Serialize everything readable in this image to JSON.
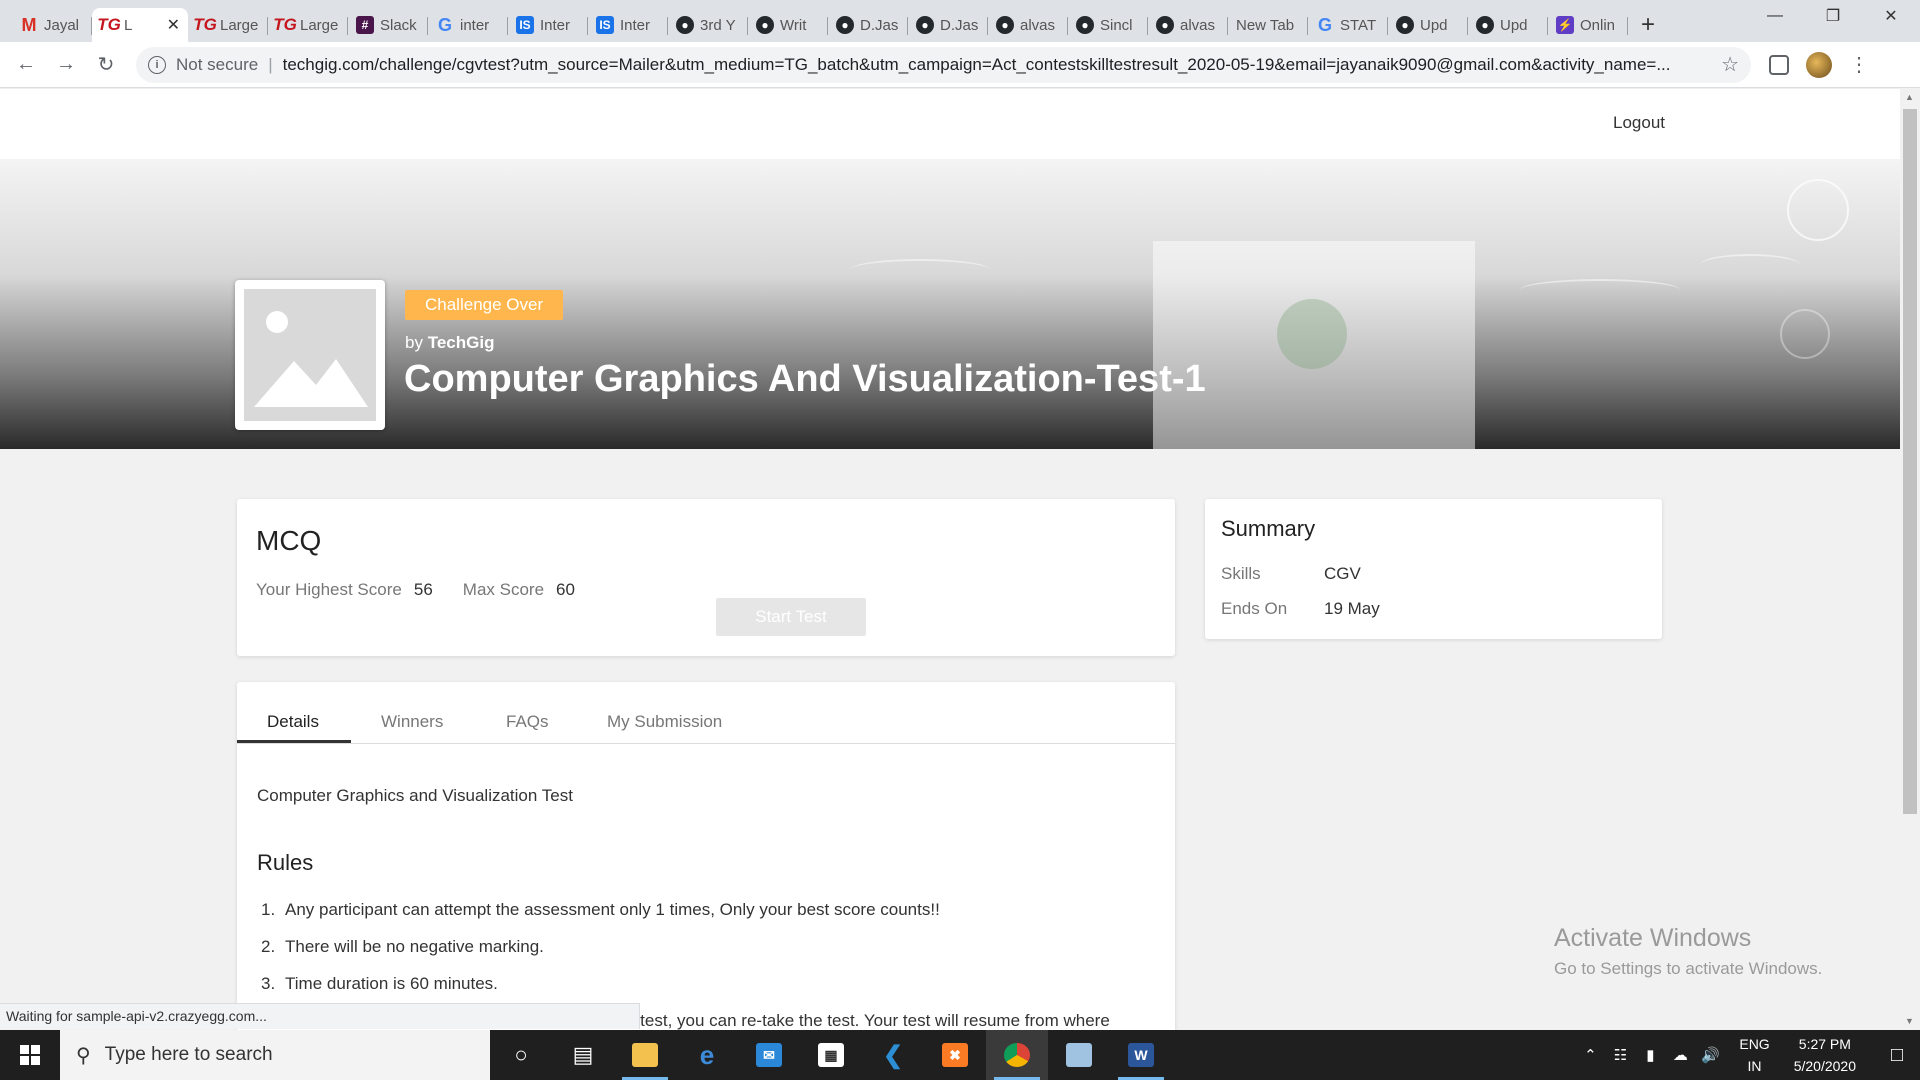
{
  "browser": {
    "tabs": [
      {
        "title": "Jayal",
        "icon": "gmail-icon",
        "glyph": "M",
        "kind": "gmail"
      },
      {
        "title": "L",
        "icon": "techgig-icon",
        "glyph": "TG",
        "kind": "tg",
        "active": true
      },
      {
        "title": "Large",
        "icon": "techgig-icon",
        "glyph": "TG",
        "kind": "tg"
      },
      {
        "title": "Large",
        "icon": "techgig-icon",
        "glyph": "TG",
        "kind": "tg"
      },
      {
        "title": "Slack",
        "icon": "slack-icon",
        "glyph": "#",
        "kind": "slack"
      },
      {
        "title": "inter",
        "icon": "google-icon",
        "glyph": "G",
        "kind": "google"
      },
      {
        "title": "Inter",
        "icon": "interviewbit-icon",
        "glyph": "IS",
        "kind": "is"
      },
      {
        "title": "Inter",
        "icon": "interviewbit-icon",
        "glyph": "IS",
        "kind": "is"
      },
      {
        "title": "3rd Y",
        "icon": "github-icon",
        "glyph": "●",
        "kind": "gh"
      },
      {
        "title": "Writ",
        "icon": "github-icon",
        "glyph": "●",
        "kind": "gh"
      },
      {
        "title": "D.Jas",
        "icon": "github-icon",
        "glyph": "●",
        "kind": "gh"
      },
      {
        "title": "D.Jas",
        "icon": "github-icon",
        "glyph": "●",
        "kind": "gh"
      },
      {
        "title": "alvas",
        "icon": "github-icon",
        "glyph": "●",
        "kind": "gh"
      },
      {
        "title": "Sincl",
        "icon": "github-icon",
        "glyph": "●",
        "kind": "gh"
      },
      {
        "title": "alvas",
        "icon": "github-icon",
        "glyph": "●",
        "kind": "gh"
      },
      {
        "title": "New Tab",
        "icon": "",
        "glyph": "",
        "kind": "none"
      },
      {
        "title": "STAT",
        "icon": "google-icon",
        "glyph": "G",
        "kind": "google"
      },
      {
        "title": "Upd",
        "icon": "github-icon",
        "glyph": "●",
        "kind": "gh"
      },
      {
        "title": "Upd",
        "icon": "github-icon",
        "glyph": "●",
        "kind": "gh"
      },
      {
        "title": "Onlin",
        "icon": "bolt-icon",
        "glyph": "⚡",
        "kind": "bolt"
      }
    ],
    "security_label": "Not secure",
    "url": "techgig.com/challenge/cgvtest?utm_source=Mailer&utm_medium=TG_batch&utm_campaign=Act_contestskilltestresult_2020-05-19&email=jayanaik9090@gmail.com&activity_name=...",
    "status_text": "Waiting for sample-api-v2.crazyegg.com..."
  },
  "site": {
    "logout_label": "Logout"
  },
  "hero": {
    "badge": "Challenge Over",
    "by_prefix": "by",
    "by_name": "TechGig",
    "title": "Computer Graphics And Visualization-Test-1"
  },
  "mcq": {
    "heading": "MCQ",
    "highest_label": "Your Highest Score",
    "highest_value": "56",
    "max_label": "Max Score",
    "max_value": "60",
    "start_label": "Start Test"
  },
  "summary": {
    "heading": "Summary",
    "skills_label": "Skills",
    "skills_value": "CGV",
    "ends_label": "Ends On",
    "ends_value": "19 May"
  },
  "details": {
    "tabs": [
      "Details",
      "Winners",
      "FAQs",
      "My Submission"
    ],
    "description": "Computer Graphics and Visualization Test",
    "rules_heading": "Rules",
    "rules": [
      "Any participant can attempt the assessment only 1 times, Only your best score counts!!",
      "There will be no negative marking.",
      "Time duration is 60 minutes."
    ],
    "rule4_partial": "e test, you can re-take the test. Your test will resume from where"
  },
  "watermark": {
    "line1": "Activate Windows",
    "line2": "Go to Settings to activate Windows."
  },
  "taskbar": {
    "search_placeholder": "Type here to search",
    "lang_top": "ENG",
    "lang_bottom": "IN",
    "time": "5:27 PM",
    "date": "5/20/2020"
  }
}
